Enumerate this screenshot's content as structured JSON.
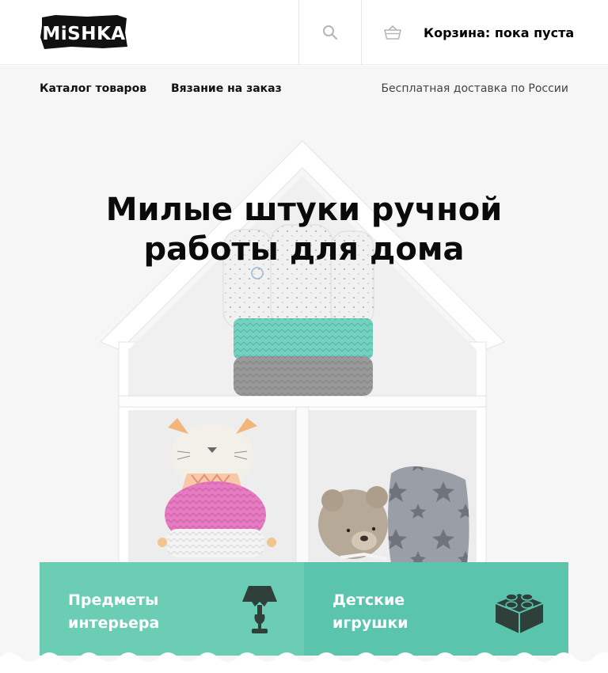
{
  "header": {
    "logo_text": "MiSHKA",
    "search_icon": "search-icon",
    "cart_icon": "basket-icon",
    "cart_label": "Корзина: пока пуста"
  },
  "nav": {
    "catalog": "Каталог товаров",
    "custom_knitting": "Вязание на заказ",
    "delivery": "Бесплатная доставка по России"
  },
  "hero": {
    "title": "Милые штуки ручной работы для дома"
  },
  "categories": [
    {
      "label": "Предметы\nинтерьера",
      "icon": "table-lamp-icon",
      "color": "#6acdb4"
    },
    {
      "label": "Детские\nигрушки",
      "icon": "toy-block-icon",
      "color": "#5bc4ad"
    }
  ],
  "colors": {
    "accent": "#6acdb4",
    "accent_dark": "#5bc4ad",
    "icon_dark": "#2f3f3a"
  }
}
